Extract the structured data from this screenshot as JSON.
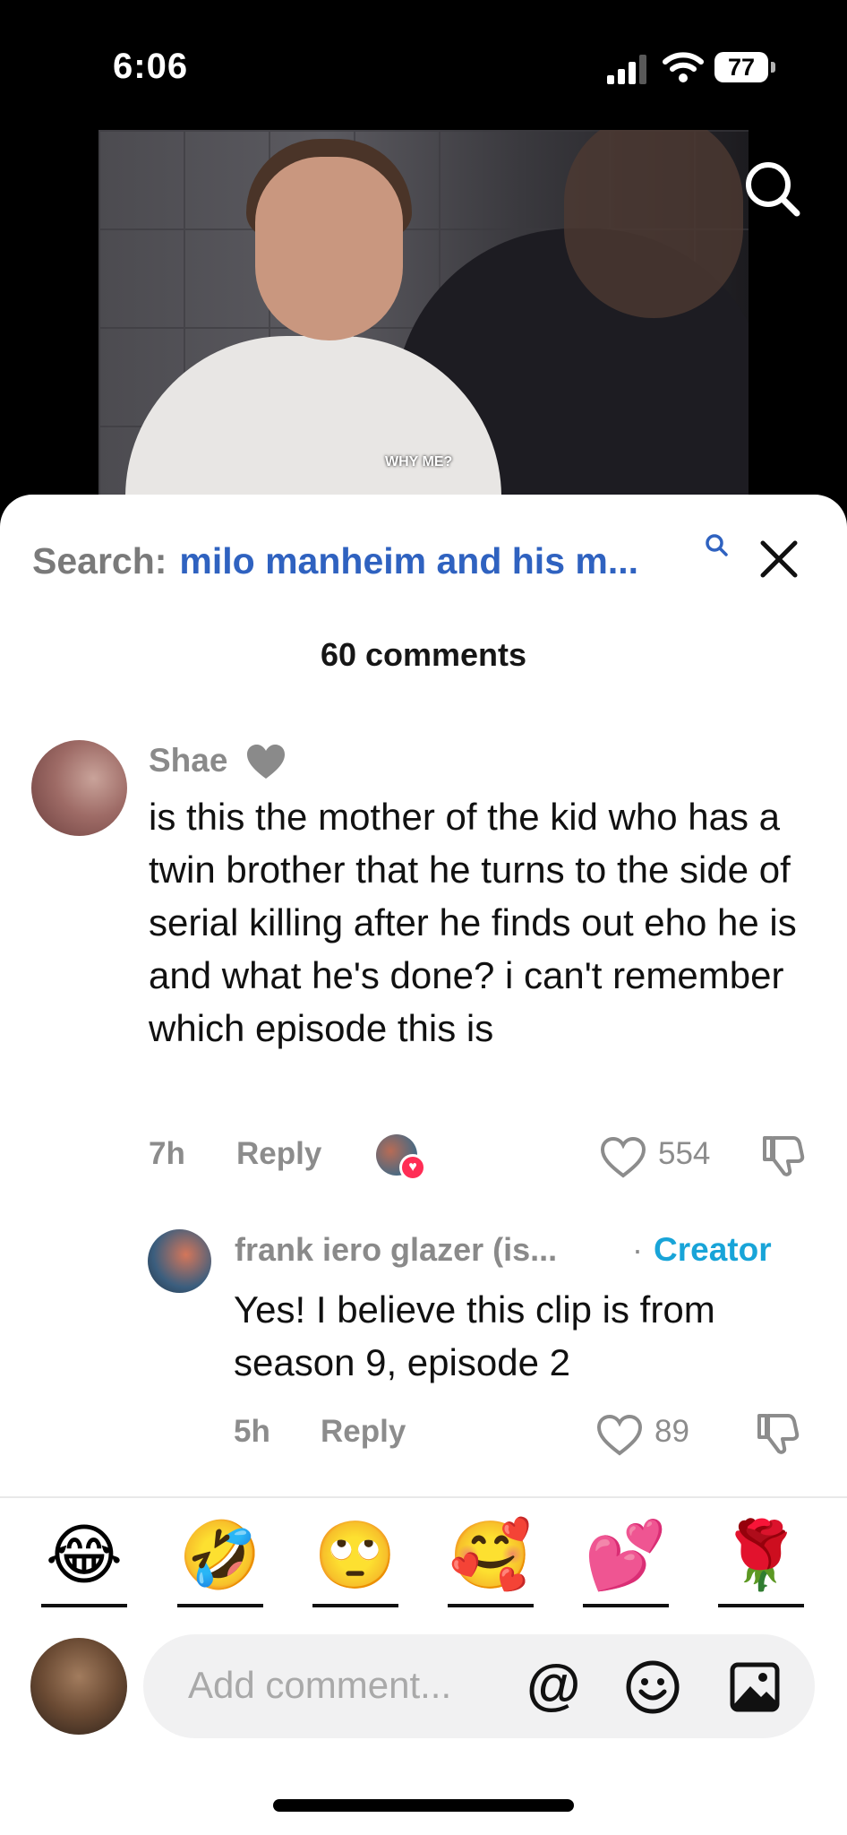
{
  "status_bar": {
    "time": "6:06",
    "battery": "77"
  },
  "video": {
    "subtitle": "WHY ME?"
  },
  "search": {
    "prefix": "Search:",
    "query": "milo manheim and his m..."
  },
  "comments_count": "60 comments",
  "comments": [
    {
      "author": "Shae",
      "badge_icon": "grey-heart-icon",
      "text": "is this the mother of the kid who has a twin brother that he turns to the side of serial killing after he finds out eho he is and what he's done? i can't remember which episode this is",
      "time": "7h",
      "reply_label": "Reply",
      "likes": "554"
    },
    {
      "author": "frank iero glazer (is...",
      "role": "Creator",
      "text": "Yes! I believe this clip is from season 9, episode 2",
      "time": "5h",
      "reply_label": "Reply",
      "likes": "89"
    }
  ],
  "quick_emojis": [
    "😂",
    "🤣",
    "🙄",
    "🥰",
    "💕",
    "🌹"
  ],
  "composer": {
    "placeholder": "Add comment...",
    "at_symbol": "@"
  },
  "colors": {
    "link_blue": "#2f62c0",
    "creator_blue": "#18a4d8",
    "like_red": "#ff2d55"
  }
}
